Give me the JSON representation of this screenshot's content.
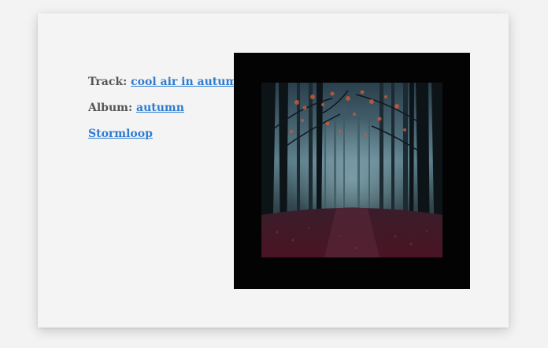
{
  "track": {
    "label": "Track:",
    "title": "cool air in autumn"
  },
  "album": {
    "label": "Album:",
    "title": "autumn"
  },
  "artist": {
    "name": "Stormloop"
  },
  "cover_art": {
    "description_icon": "forest-image"
  },
  "colors": {
    "link": "#2f7bd0",
    "label": "#555555",
    "frame": "#030303",
    "background": "#f4f4f4"
  }
}
